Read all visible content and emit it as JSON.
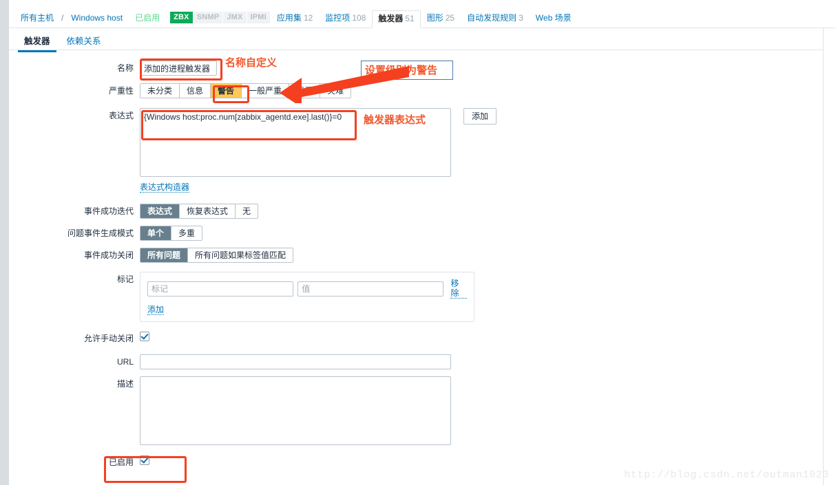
{
  "host_nav": {
    "breadcrumb_all_hosts": "所有主机",
    "separator": "/",
    "host_name": "Windows host",
    "status": "已启用",
    "badges": [
      {
        "label": "ZBX",
        "state": "on"
      },
      {
        "label": "SNMP",
        "state": "off"
      },
      {
        "label": "JMX",
        "state": "off"
      },
      {
        "label": "IPMI",
        "state": "off"
      }
    ],
    "items": [
      {
        "label": "应用集",
        "count": "12",
        "active": false
      },
      {
        "label": "监控项",
        "count": "108",
        "active": false
      },
      {
        "label": "触发器",
        "count": "51",
        "active": true
      },
      {
        "label": "图形",
        "count": "25",
        "active": false
      },
      {
        "label": "自动发现规则",
        "count": "3",
        "active": false
      },
      {
        "label": "Web 场景",
        "count": "",
        "active": false
      }
    ]
  },
  "tabs": [
    {
      "label": "触发器",
      "active": true
    },
    {
      "label": "依赖关系",
      "active": false
    }
  ],
  "form": {
    "name_label": "名称",
    "name_value": "添加的进程触发器",
    "severity_label": "严重性",
    "severity_options": [
      "未分类",
      "信息",
      "警告",
      "一般严重",
      "严重",
      "灾难"
    ],
    "severity_selected": "警告",
    "expression_label": "表达式",
    "expression_value": "{Windows host:proc.num[zabbix_agentd.exe].last()}=0",
    "expression_add_button": "添加",
    "expression_constructor_link": "表达式构造器",
    "ok_event_label": "事件成功迭代",
    "ok_event_options": [
      "表达式",
      "恢复表达式",
      "无"
    ],
    "ok_event_selected": "表达式",
    "problem_event_label": "问题事件生成模式",
    "problem_event_options": [
      "单个",
      "多重"
    ],
    "problem_event_selected": "单个",
    "close_event_label": "事件成功关闭",
    "close_event_options": [
      "所有问题",
      "所有问题如果标签值匹配"
    ],
    "close_event_selected": "所有问题",
    "tags_label": "标记",
    "tag_key_placeholder": "标记",
    "tag_value_placeholder": "值",
    "tag_remove_link": "移除",
    "tag_add_link": "添加",
    "manual_close_label": "允许手动关闭",
    "manual_close_checked": true,
    "url_label": "URL",
    "url_value": "",
    "description_label": "描述",
    "description_value": "",
    "enabled_label": "已启用",
    "enabled_checked": true
  },
  "annotations": {
    "name_note": "名称自定义",
    "severity_note": "设置级别为警告",
    "expression_note": "触发器表达式"
  },
  "watermark": "http://blog.csdn.net/outman1023",
  "colors": {
    "accent_blue": "#0275b8",
    "annotation_red": "#f1582c",
    "severity_warning_bg": "#ffc859",
    "segment_selected_bg": "#68808e",
    "zbx_badge_green": "#0eaa59"
  }
}
